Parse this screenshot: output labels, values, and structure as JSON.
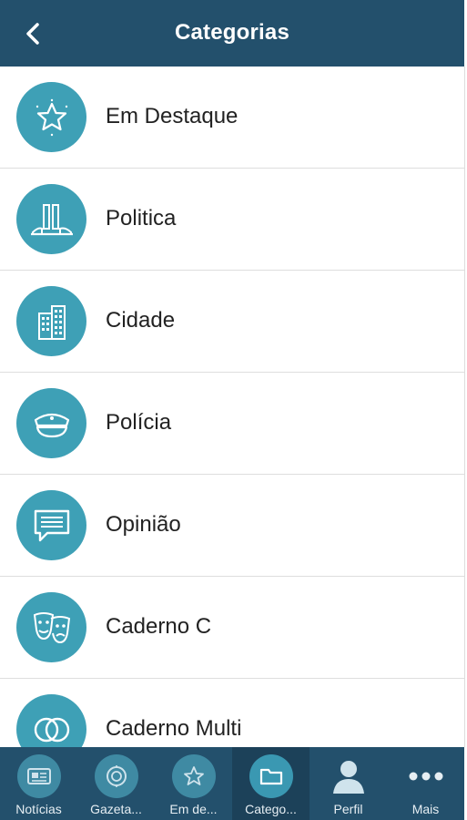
{
  "header": {
    "title": "Categorias"
  },
  "categories": [
    {
      "label": "Em Destaque",
      "icon": "star-badge-icon"
    },
    {
      "label": "Politica",
      "icon": "congress-building-icon"
    },
    {
      "label": "Cidade",
      "icon": "city-buildings-icon"
    },
    {
      "label": "Polícia",
      "icon": "police-cap-icon"
    },
    {
      "label": "Opinião",
      "icon": "speech-bubble-icon"
    },
    {
      "label": "Caderno C",
      "icon": "theater-masks-icon"
    },
    {
      "label": "Caderno Multi",
      "icon": "overlapping-circles-icon"
    }
  ],
  "tabbar": {
    "items": [
      {
        "label": "Notícias",
        "icon": "newspaper-icon"
      },
      {
        "label": "Gazeta...",
        "icon": "gazeta-seal-icon"
      },
      {
        "label": "Em de...",
        "icon": "star-badge-icon"
      },
      {
        "label": "Catego...",
        "icon": "folder-icon"
      },
      {
        "label": "Perfil",
        "icon": "person-icon"
      },
      {
        "label": "Mais",
        "icon": "more-dots-icon"
      }
    ],
    "active_index": 3
  },
  "colors": {
    "header_bg": "#23506c",
    "accent_circle": "#3ea0b6",
    "tabbar_bg": "#23506c"
  }
}
